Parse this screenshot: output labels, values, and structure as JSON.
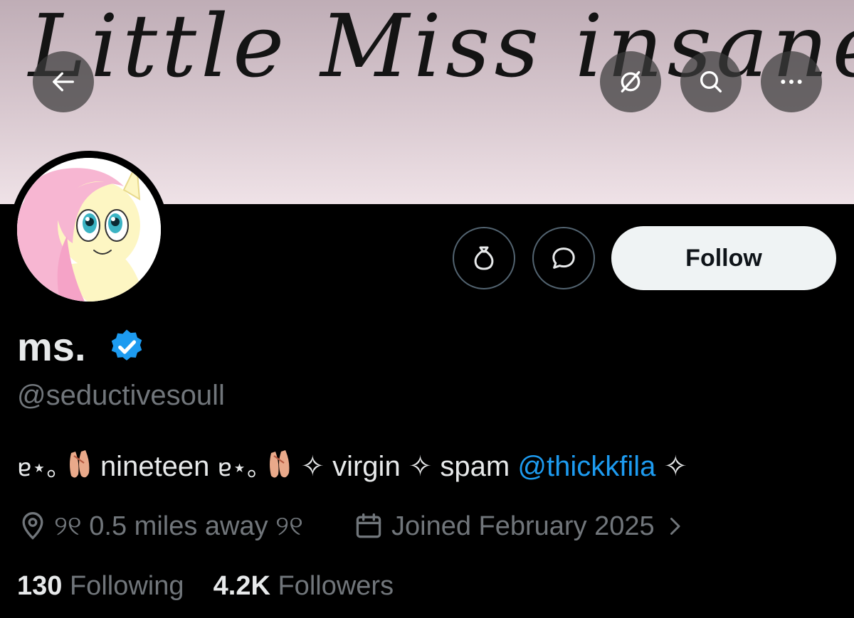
{
  "banner": {
    "text": "Little Miss insane"
  },
  "nav": {
    "back_icon": "arrow-left-icon",
    "grok_icon": "slash-circle-icon",
    "search_icon": "search-icon",
    "more_icon": "more-icon"
  },
  "actions": {
    "subscribe_icon": "money-bag-icon",
    "message_icon": "message-icon",
    "follow_label": "Follow"
  },
  "profile": {
    "display_name": "ms.",
    "handle": "@seductivesoull",
    "verified_color": "#1d9bf0",
    "bio": {
      "part1": "ɐ⋆｡",
      "part2": " nineteen ",
      "part3": "ɐ⋆｡",
      "part4": " ✧ virgin ✧ spam ",
      "mention": "@thickkfila",
      "part5": " ✧"
    },
    "location": "୨୧ 0.5 miles away ୨୧",
    "joined": "Joined February 2025"
  },
  "stats": {
    "following_count": "130",
    "following_label": "Following",
    "followers_count": "4.2K",
    "followers_label": "Followers"
  },
  "colors": {
    "accent": "#1d9bf0",
    "muted": "#71767b",
    "text": "#e7e9ea",
    "background": "#000000"
  }
}
